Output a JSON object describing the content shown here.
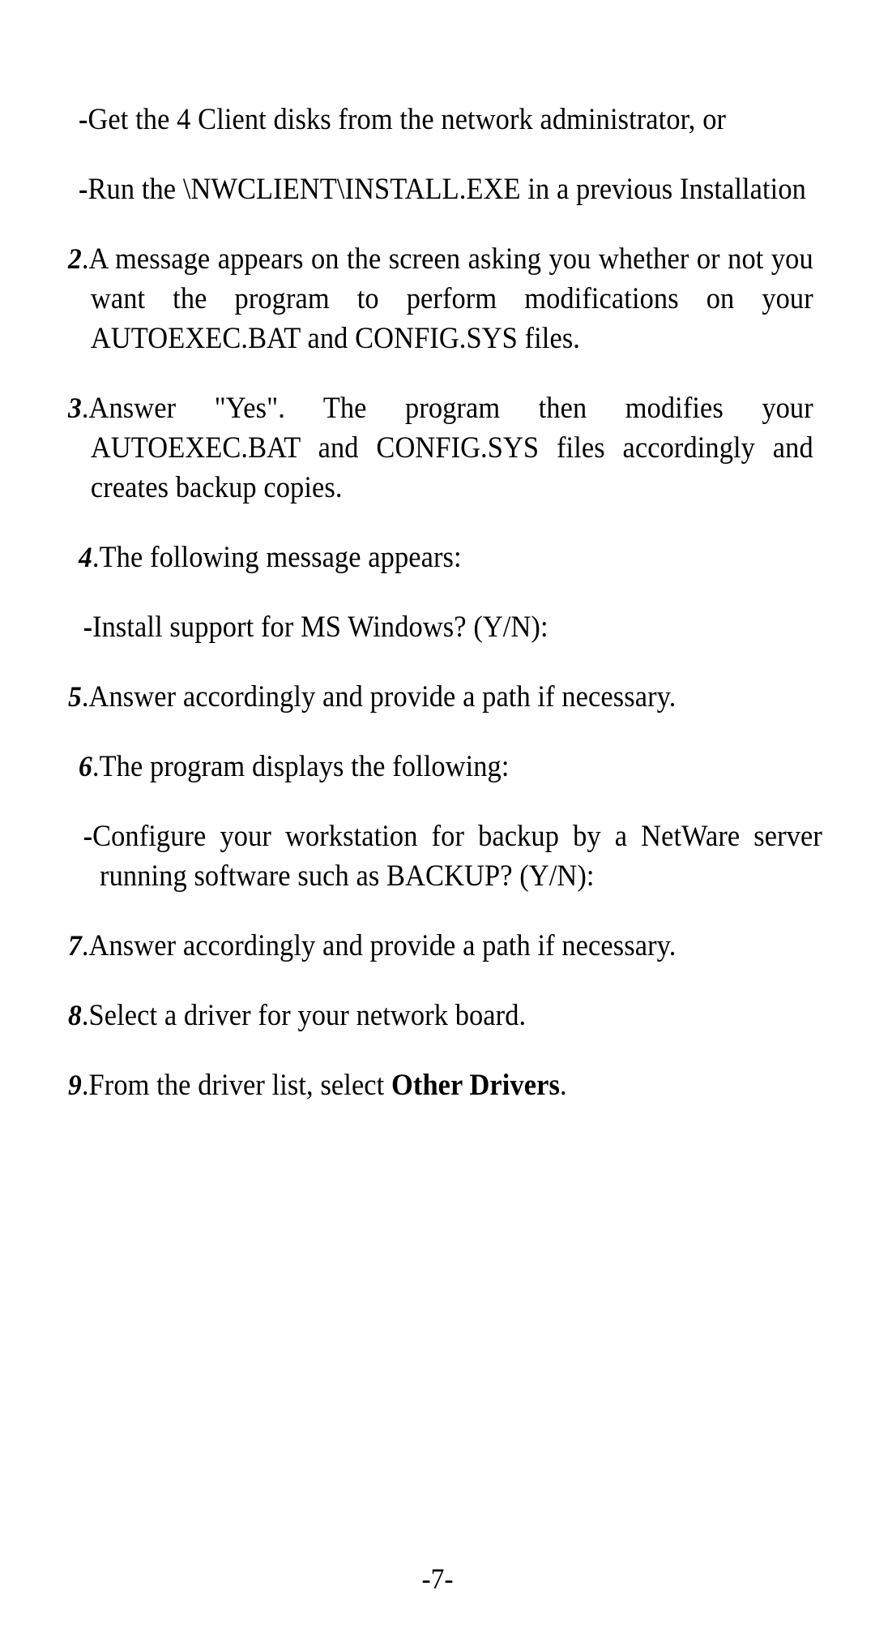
{
  "document": {
    "page_number_label": "-7-",
    "blocks": [
      {
        "kind": "bullet",
        "indent": "normal",
        "marker": "-",
        "text": "Get the 4 Client disks from the network administrator, or"
      },
      {
        "kind": "bullet",
        "indent": "normal",
        "marker": "-",
        "text": "Run the \\NWCLIENT\\INSTALL.EXE in a previous Installation"
      },
      {
        "kind": "numbered",
        "indent": "normal",
        "marker": "2",
        "marker_dot": ".",
        "text": "A message appears on the screen asking you whether or not you want the program to perform modifications on your AUTOEXEC.BAT and CONFIG.SYS files."
      },
      {
        "kind": "numbered",
        "indent": "normal",
        "marker": "3",
        "marker_dot": ".",
        "text": "Answer \"Yes\". The program then modifies your AUTOEXEC.BAT and CONFIG.SYS files accordingly and creates backup copies."
      },
      {
        "kind": "numbered",
        "indent": "deep",
        "marker": "4",
        "marker_dot": ".",
        "text": "The following message appears:"
      },
      {
        "kind": "bullet",
        "indent": "deep",
        "marker": "-",
        "text": "Install support for MS Windows? (Y/N):"
      },
      {
        "kind": "numbered",
        "indent": "normal",
        "marker": "5",
        "marker_dot": ".",
        "text": "Answer accordingly and provide a path if necessary."
      },
      {
        "kind": "numbered",
        "indent": "deep",
        "marker": "6",
        "marker_dot": ".",
        "text": "The program displays the following:"
      },
      {
        "kind": "bullet",
        "indent": "deep",
        "marker": "-",
        "text": "Configure your workstation for backup by a NetWare server running software such as BACKUP? (Y/N):"
      },
      {
        "kind": "numbered",
        "indent": "normal",
        "marker": "7",
        "marker_dot": ".",
        "text": "Answer accordingly and provide a path if necessary."
      },
      {
        "kind": "numbered",
        "indent": "normal",
        "marker": "8",
        "marker_dot": ".",
        "text": "Select a driver for your network board."
      },
      {
        "kind": "numbered",
        "indent": "normal",
        "marker": "9",
        "marker_dot": ".",
        "text_before": "From the driver list, select ",
        "text_bold": "Other Drivers",
        "text_after": "."
      }
    ]
  }
}
